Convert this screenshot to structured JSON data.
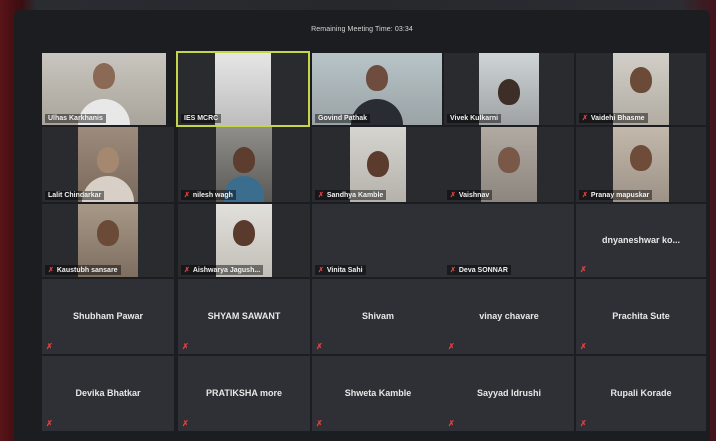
{
  "meeting": {
    "timer_text": "Remaining Meeting Time: 03:34"
  },
  "colors": {
    "tile_bg": "#2e3035",
    "active_speaker_outline": "#c6d64a",
    "mute_icon": "#e04040"
  },
  "video_tiles": [
    {
      "name": "Ulhas Karkhanis",
      "muted": false
    },
    {
      "name": "IES MCRC",
      "muted": false,
      "active": true
    },
    {
      "name": "Govind Pathak",
      "muted": false
    },
    {
      "name": "Vivek Kulkarni",
      "muted": false
    },
    {
      "name": "Vaidehi Bhasme",
      "muted": true
    },
    {
      "name": "Lalit Chindarkar",
      "muted": false
    },
    {
      "name": "nilesh wagh",
      "muted": true
    },
    {
      "name": "Sandhya Kamble",
      "muted": true
    },
    {
      "name": "Vaishnav",
      "muted": true
    },
    {
      "name": "Pranay mapuskar",
      "muted": true
    },
    {
      "name": "Kaustubh sansare",
      "muted": true
    },
    {
      "name": "Aishwarya Jagush...",
      "muted": true
    }
  ],
  "name_tiles": [
    {
      "name": "Vinita Sahi",
      "muted": true,
      "badge": true
    },
    {
      "name": "Deva SONNAR",
      "muted": true,
      "badge": true
    },
    {
      "name": "dnyaneshwar ko...",
      "muted": true
    },
    {
      "name": "Shubham Pawar",
      "muted": true
    },
    {
      "name": "SHYAM SAWANT",
      "muted": true
    },
    {
      "name": "Shivam",
      "muted": true
    },
    {
      "name": "vinay chavare",
      "muted": true
    },
    {
      "name": "Prachita Sute",
      "muted": true
    },
    {
      "name": "Devika Bhatkar",
      "muted": true
    },
    {
      "name": "PRATIKSHA more",
      "muted": true
    },
    {
      "name": "Shweta Kamble",
      "muted": true
    },
    {
      "name": "Sayyad Idrushi",
      "muted": true
    },
    {
      "name": "Rupali Korade",
      "muted": true
    }
  ]
}
